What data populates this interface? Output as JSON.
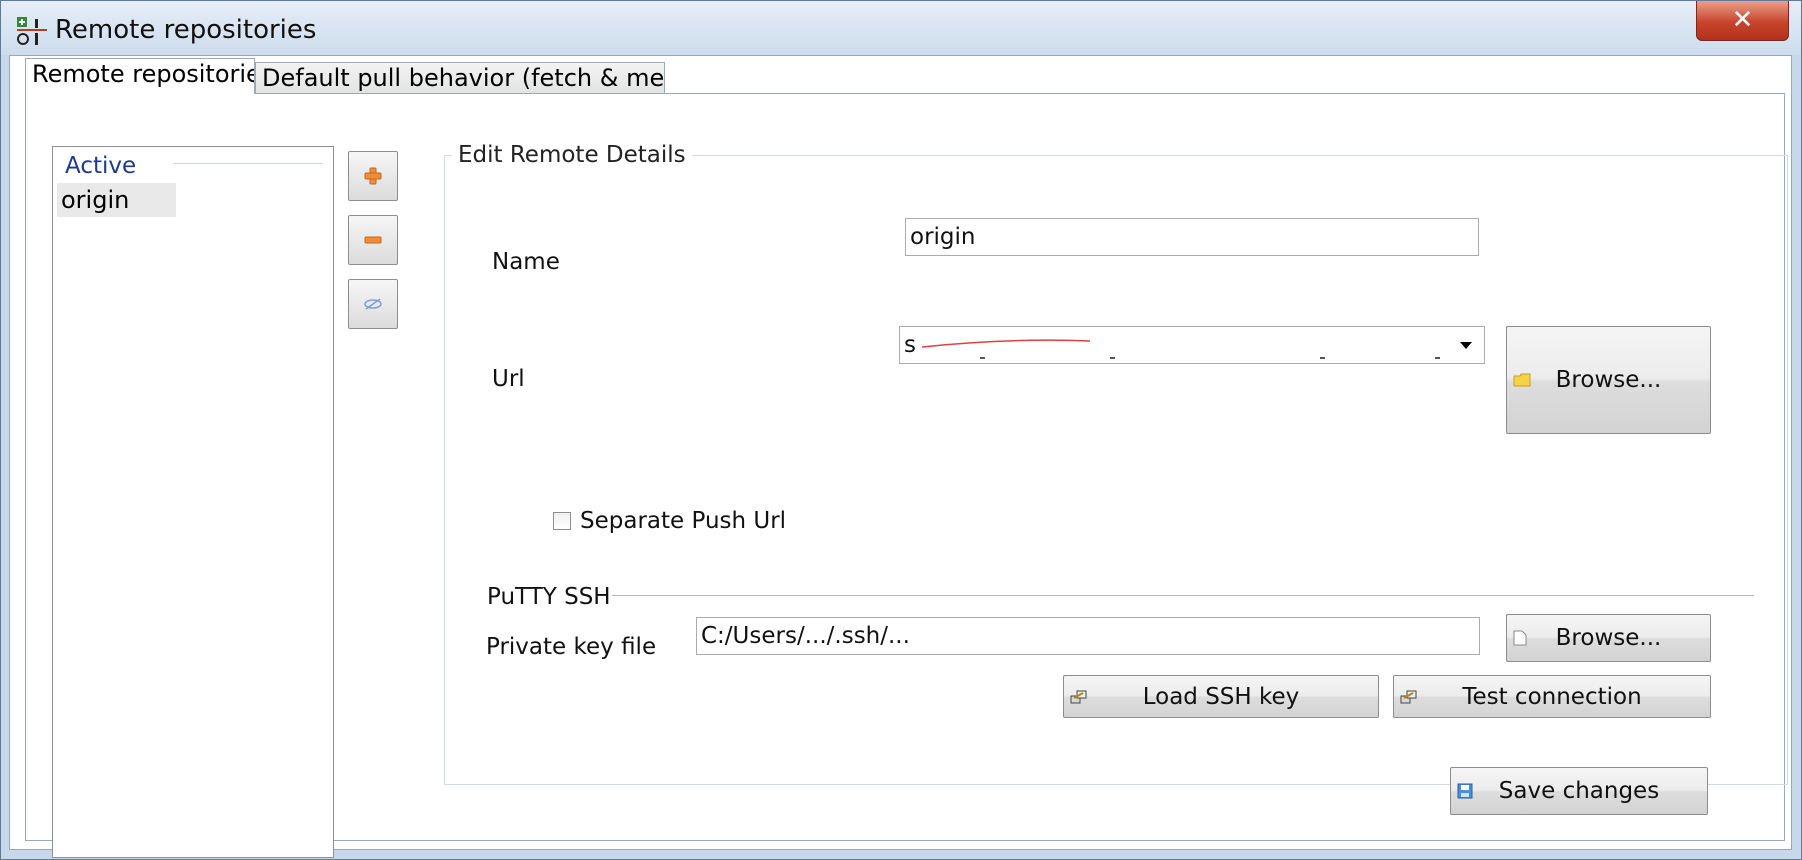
{
  "window": {
    "title": "Remote repositories",
    "close_label": "✕"
  },
  "tabs": [
    {
      "label": "Remote repositories",
      "active": true
    },
    {
      "label": "Default pull behavior (fetch & merge)",
      "active": false
    }
  ],
  "remotes_list": {
    "group_header": "Active",
    "items": [
      "origin"
    ]
  },
  "side_buttons": [
    {
      "icon": "add-icon"
    },
    {
      "icon": "remove-icon"
    },
    {
      "icon": "toggle-disable-icon"
    }
  ],
  "edit": {
    "group_title": "Edit Remote Details",
    "name_label": "Name",
    "name_value": "origin",
    "url_label": "Url",
    "url_value": "s",
    "browse_label": "Browse...",
    "separate_push_label": "Separate Push Url",
    "separate_push_checked": false
  },
  "putty": {
    "section_label": "PuTTY SSH",
    "private_key_label": "Private key file",
    "private_key_value": "C:/Users/.../.ssh/...",
    "browse_label": "Browse...",
    "load_key_label": "Load SSH key",
    "test_connection_label": "Test connection"
  },
  "save_label": "Save changes",
  "colors": {
    "accent_header": "#1e3a8a",
    "close_red": "#c7442b",
    "add_orange": "#f08c3a"
  }
}
